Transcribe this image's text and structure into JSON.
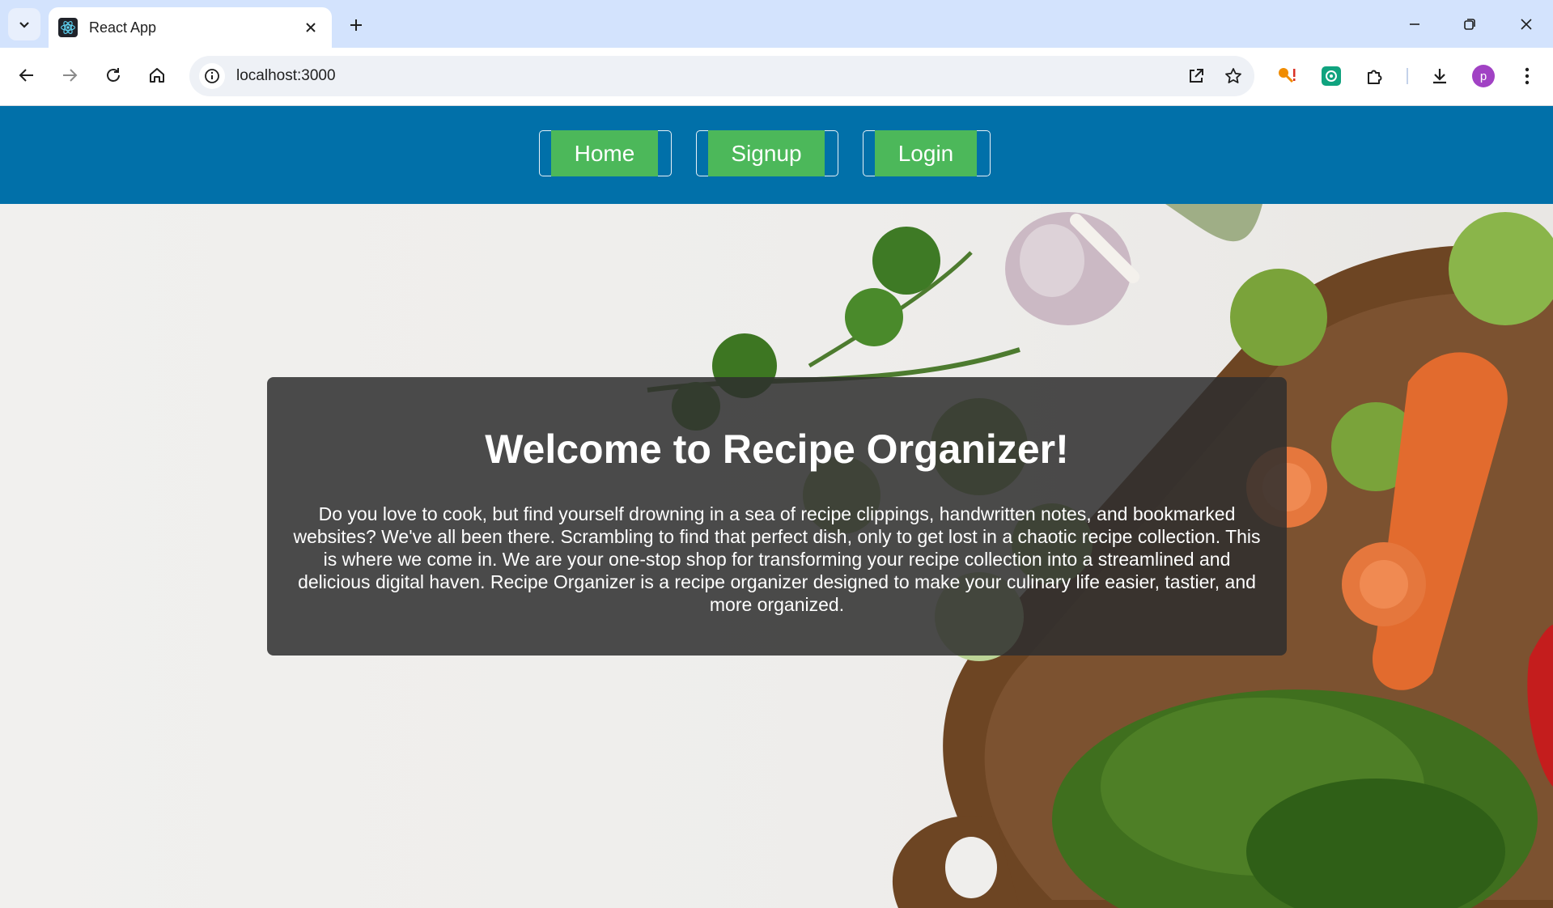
{
  "browser": {
    "tab_title": "React App",
    "url": "localhost:3000",
    "avatar_letter": "p"
  },
  "nav": {
    "home": "Home",
    "signup": "Signup",
    "login": "Login"
  },
  "hero": {
    "title": "Welcome to Recipe Organizer!",
    "description": "Do you love to cook, but find yourself drowning in a sea of recipe clippings, handwritten notes, and bookmarked websites? We've all been there. Scrambling to find that perfect dish, only to get lost in a chaotic recipe collection. This is where we come in. We are your one-stop shop for transforming your recipe collection into a streamlined and delicious digital haven. Recipe Organizer is a recipe organizer designed to make your culinary life easier, tastier, and more organized."
  },
  "colors": {
    "navbar": "#0170a9",
    "button": "#4cb85a",
    "card": "#2f2f2f"
  }
}
